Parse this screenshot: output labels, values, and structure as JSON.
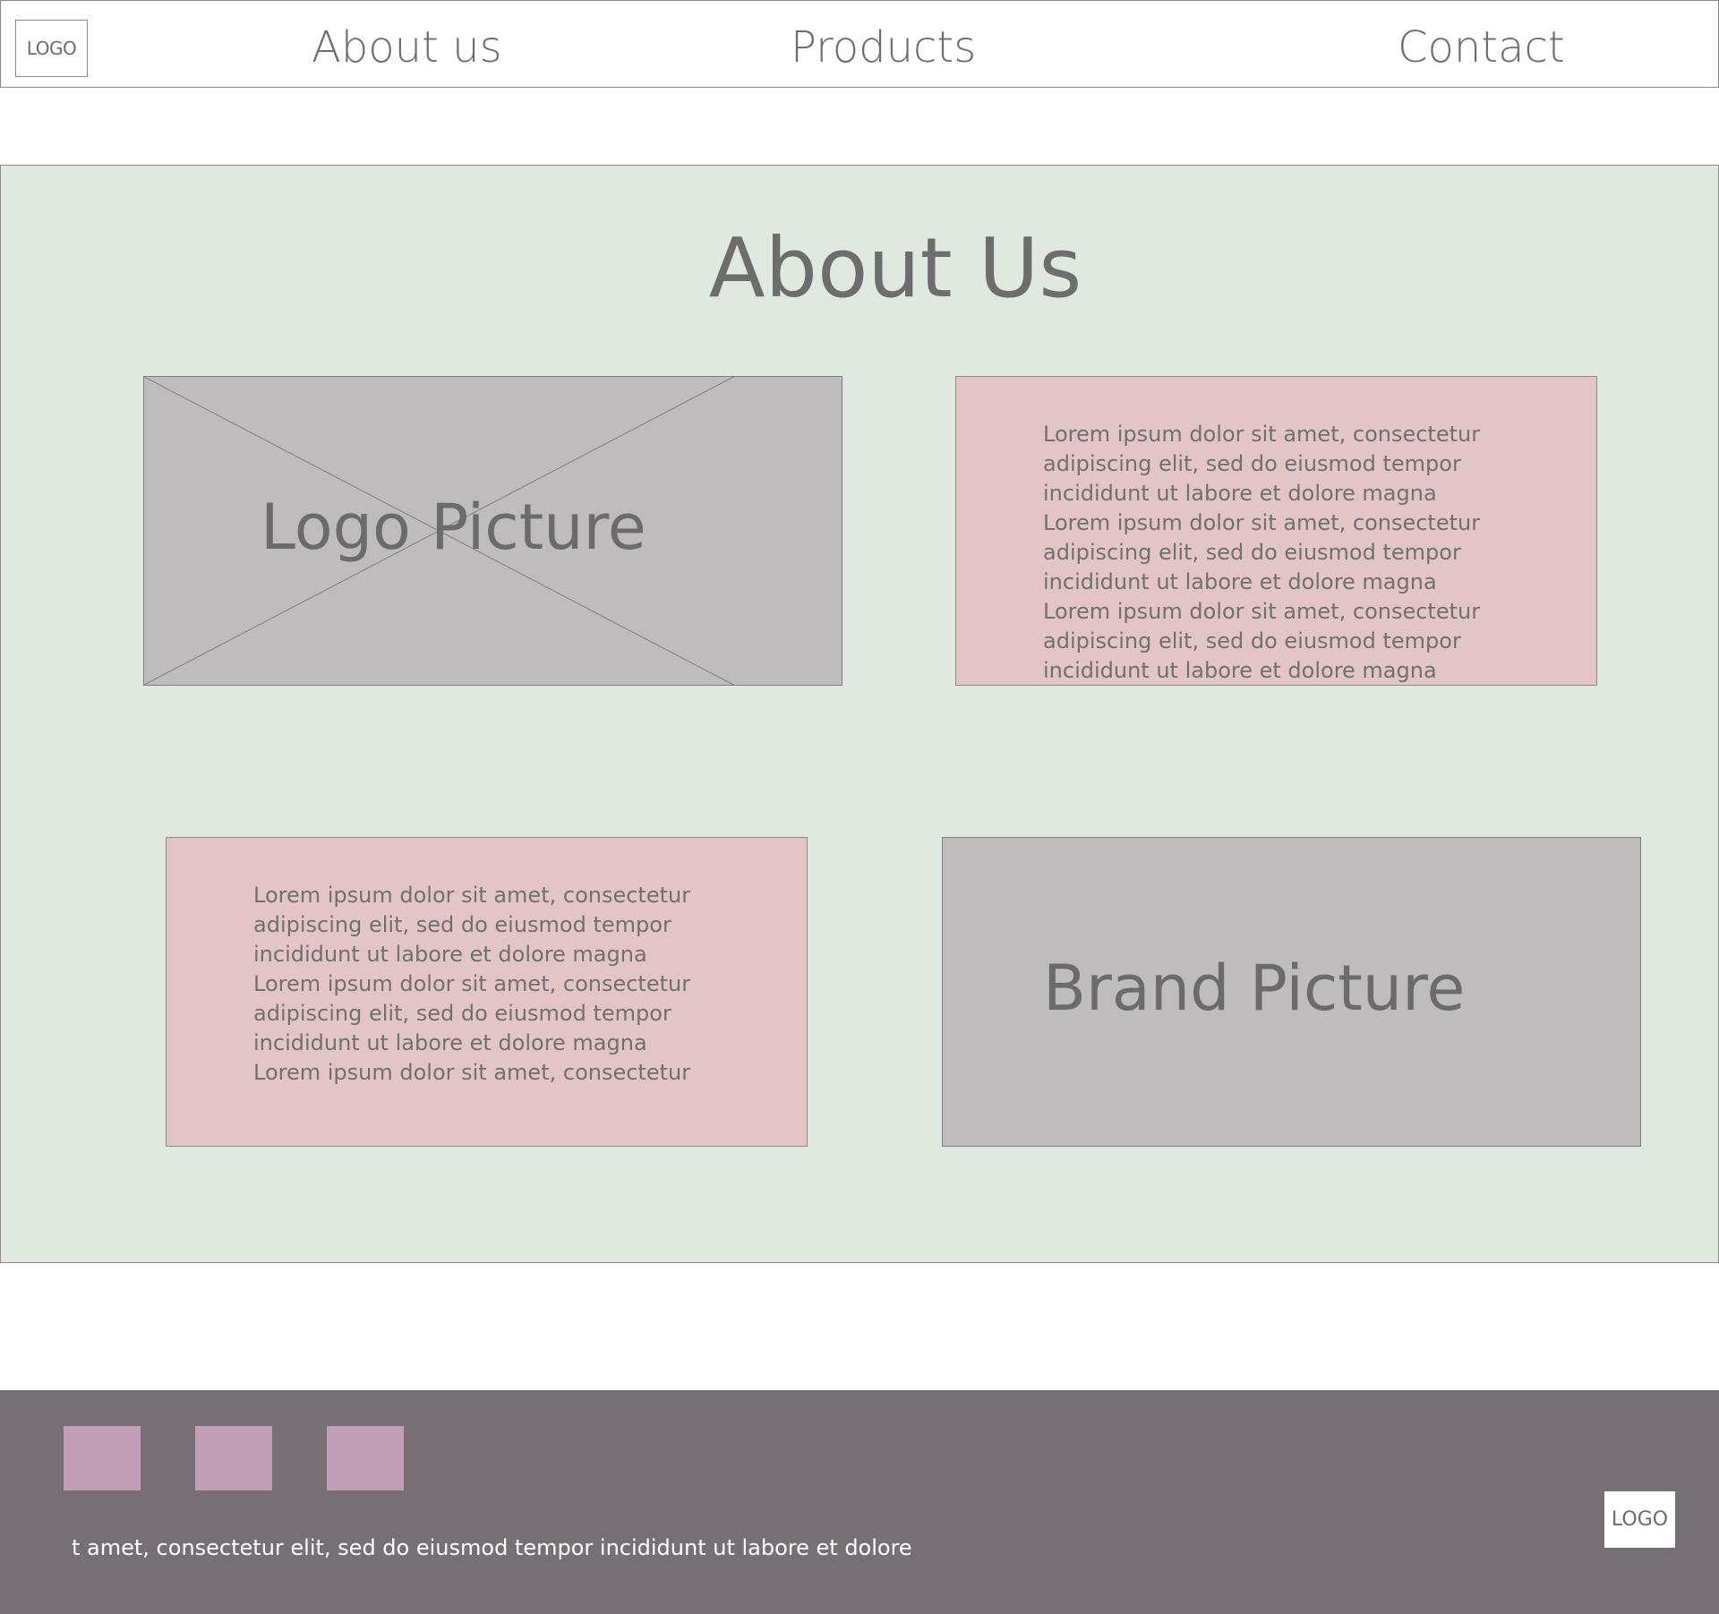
{
  "header": {
    "logo": "LOGO",
    "nav": {
      "about": "About us",
      "products": "Products",
      "contact": "Contact"
    }
  },
  "about": {
    "title": "About Us",
    "logo_picture_label": "Logo Picture",
    "brand_picture_label": "Brand Picture",
    "text_1": "Lorem ipsum dolor sit amet, consectetur\nadipiscing elit, sed do eiusmod tempor\nincididunt ut labore et dolore magna\nLorem ipsum dolor sit amet, consectetur\nadipiscing elit, sed do eiusmod tempor\nincididunt ut labore et dolore magna\nLorem ipsum dolor sit amet, consectetur\nadipiscing elit, sed do eiusmod tempor\nincididunt ut labore et dolore magna",
    "text_2": "Lorem ipsum dolor sit amet, consectetur\nadipiscing elit, sed do eiusmod tempor\nincididunt ut labore et dolore magna\nLorem ipsum dolor sit amet, consectetur\nadipiscing elit, sed do eiusmod tempor\nincididunt ut labore et dolore magna\nLorem ipsum dolor sit amet, consectetur"
  },
  "footer": {
    "text": "t amet, consectetur elit, sed do eiusmod tempor incididunt ut labore et dolore",
    "logo": "LOGO"
  },
  "colors": {
    "section_background": "#e0e9df",
    "picture_placeholder": "#bebcbd",
    "text_card": "#e3c5c6",
    "footer_background": "#767075",
    "social_square": "#c39fb7"
  }
}
